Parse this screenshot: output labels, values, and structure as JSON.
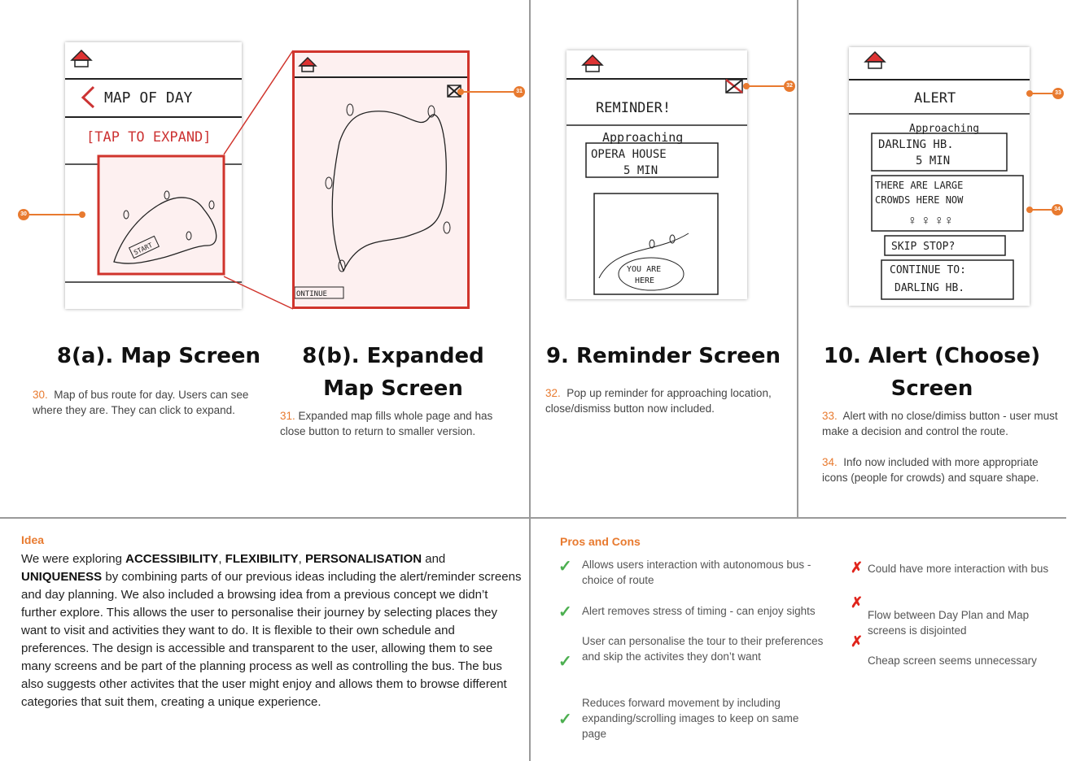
{
  "sections": [
    {
      "title": "8(a). Map Screen",
      "num": "30.",
      "desc": "Map of bus route for day. Users can see where they are.  They can click to expand."
    },
    {
      "title": "8(b). Expanded Map Screen",
      "num": "31.",
      "desc": "Expanded map fills whole page and has close button to return to smaller version."
    },
    {
      "title": "9. Reminder Screen",
      "num": "32.",
      "desc": "Pop up reminder for approaching location, close/dismiss button now included."
    },
    {
      "title": "10. Alert (Choose) Screen",
      "notes": [
        {
          "num": "33.",
          "desc": "Alert with no close/dimiss button - user must make a decision and control the route."
        },
        {
          "num": "34.",
          "desc": "Info now included with more appropriate icons (people for crowds) and square shape."
        }
      ]
    }
  ],
  "callouts": [
    "30",
    "31",
    "32",
    "33",
    "34"
  ],
  "sketches": {
    "map": {
      "header": "MAP OF DAY",
      "tap": "[TAP TO EXPAND]",
      "start": "START"
    },
    "expanded": {
      "continue": "ONTINUE"
    },
    "reminder": {
      "title": "REMINDER!",
      "approaching": "Approaching",
      "place": "OPERA HOUSE",
      "time": "5 MIN",
      "you": "YOU ARE",
      "here": "HERE"
    },
    "alert": {
      "title": "ALERT",
      "approaching": "Approaching",
      "place": "DARLING HB.",
      "time": "5 MIN",
      "crowd1": "THERE ARE LARGE",
      "crowd2": "CROWDS HERE NOW",
      "skip": "SKIP STOP?",
      "cont1": "CONTINUE TO:",
      "cont2": "DARLING HB."
    }
  },
  "idea": {
    "heading": "Idea",
    "parts": [
      "We were exploring ",
      "ACCESSIBILITY",
      ", ",
      "FLEXIBILITY",
      ", ",
      "PERSONALISATION",
      " and ",
      "UNIQUENESS",
      " by combining parts of our previous ideas including the alert/reminder screens and day planning. We also included a browsing idea from a previous concept we didn’t further explore. This allows the user to personalise their journey by selecting places they want to visit and activities they want to do. It is flexible to their own schedule and preferences. The design is accessible and transparent to the user, allowing them to see many screens and be part of the planning process as well as controlling the bus. The bus also suggests other activites that the user might enjoy and allows them to browse different categories that suit them, creating a unique experience."
    ]
  },
  "pros_cons": {
    "heading": "Pros and Cons",
    "pros": [
      "Allows users interaction with autonomous bus - choice of route",
      "Alert removes stress of timing - can enjoy sights",
      "User can personalise the tour to their preferences and skip the activites they don’t want",
      "Reduces forward movement by including expanding/scrolling images to keep on same page"
    ],
    "cons": [
      "Could have more interaction with bus",
      "Flow between Day Plan and Map screens is disjointed",
      "Cheap screen seems unnecessary"
    ]
  },
  "colors": {
    "accent": "#e87a2f",
    "check": "#4caf50",
    "cross": "#e0241b",
    "highlight": "#d0342c"
  },
  "icons": {
    "check": "check-icon",
    "cross": "cross-icon",
    "home": "home-icon"
  }
}
